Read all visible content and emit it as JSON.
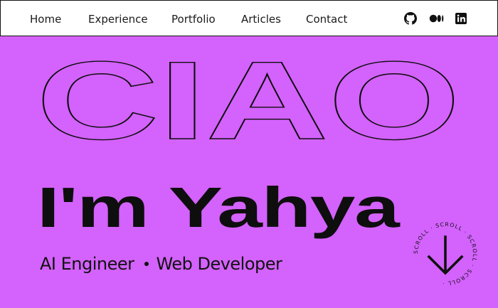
{
  "nav": {
    "links": [
      {
        "label": "Home"
      },
      {
        "label": "Experience"
      },
      {
        "label": "Portfolio"
      },
      {
        "label": "Articles"
      },
      {
        "label": "Contact"
      }
    ],
    "social": [
      "github-icon",
      "medium-icon",
      "linkedin-icon"
    ]
  },
  "hero": {
    "greeting": "CIAO",
    "name": "I'm Yahya",
    "roles": [
      "AI Engineer",
      "Web Developer"
    ]
  },
  "scroll_badge": {
    "text": "SCROLL · SCROLL · SCROLL · SCROLL ·",
    "icon": "arrow-down-icon"
  },
  "colors": {
    "background": "#d462fd",
    "navbar": "#ffffff",
    "ink": "#0e0e0e"
  }
}
